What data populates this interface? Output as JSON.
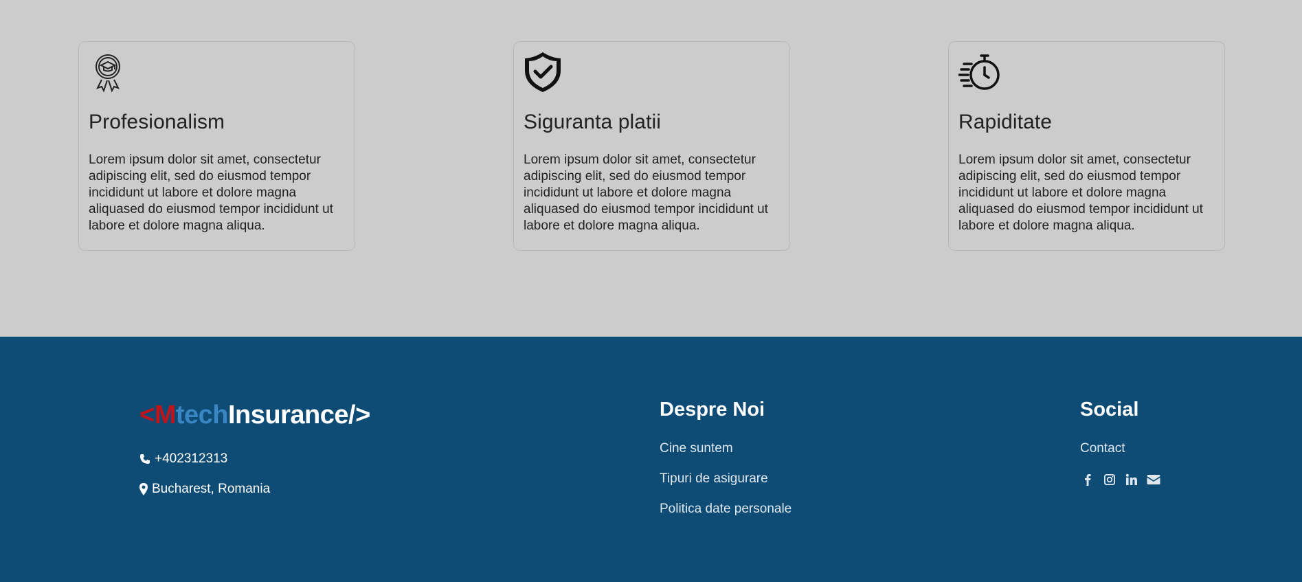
{
  "features": [
    {
      "icon": "award-graduation-icon",
      "title": "Profesionalism",
      "text": "Lorem ipsum dolor sit amet, consectetur adipiscing elit, sed do eiusmod tempor incididunt ut labore et dolore magna aliquased do eiusmod tempor incididunt ut labore et dolore magna aliqua."
    },
    {
      "icon": "shield-check-icon",
      "title": "Siguranta platii",
      "text": "Lorem ipsum dolor sit amet, consectetur adipiscing elit, sed do eiusmod tempor incididunt ut labore et dolore magna aliquased do eiusmod tempor incididunt ut labore et dolore magna aliqua."
    },
    {
      "icon": "stopwatch-fast-icon",
      "title": "Rapiditate",
      "text": "Lorem ipsum dolor sit amet, consectetur adipiscing elit, sed do eiusmod tempor incididunt ut labore et dolore magna aliquased do eiusmod tempor incididunt ut labore et dolore magna aliqua."
    }
  ],
  "footer": {
    "logo": {
      "open": "<",
      "m": "M",
      "tech": "tech",
      "rest": "Insurance/>"
    },
    "phone": "+402312313",
    "address": "Bucharest, Romania",
    "about": {
      "title": "Despre Noi",
      "links": [
        "Cine suntem",
        "Tipuri de asigurare",
        "Politica date personale"
      ]
    },
    "social": {
      "title": "Social",
      "contact": "Contact",
      "icons": [
        "facebook-icon",
        "instagram-icon",
        "linkedin-icon",
        "envelope-icon"
      ]
    }
  },
  "colors": {
    "page_bg": "#cccccc",
    "footer_bg": "#0f4c75",
    "logo_red": "#c0141c",
    "logo_blue": "#3a86c3"
  }
}
